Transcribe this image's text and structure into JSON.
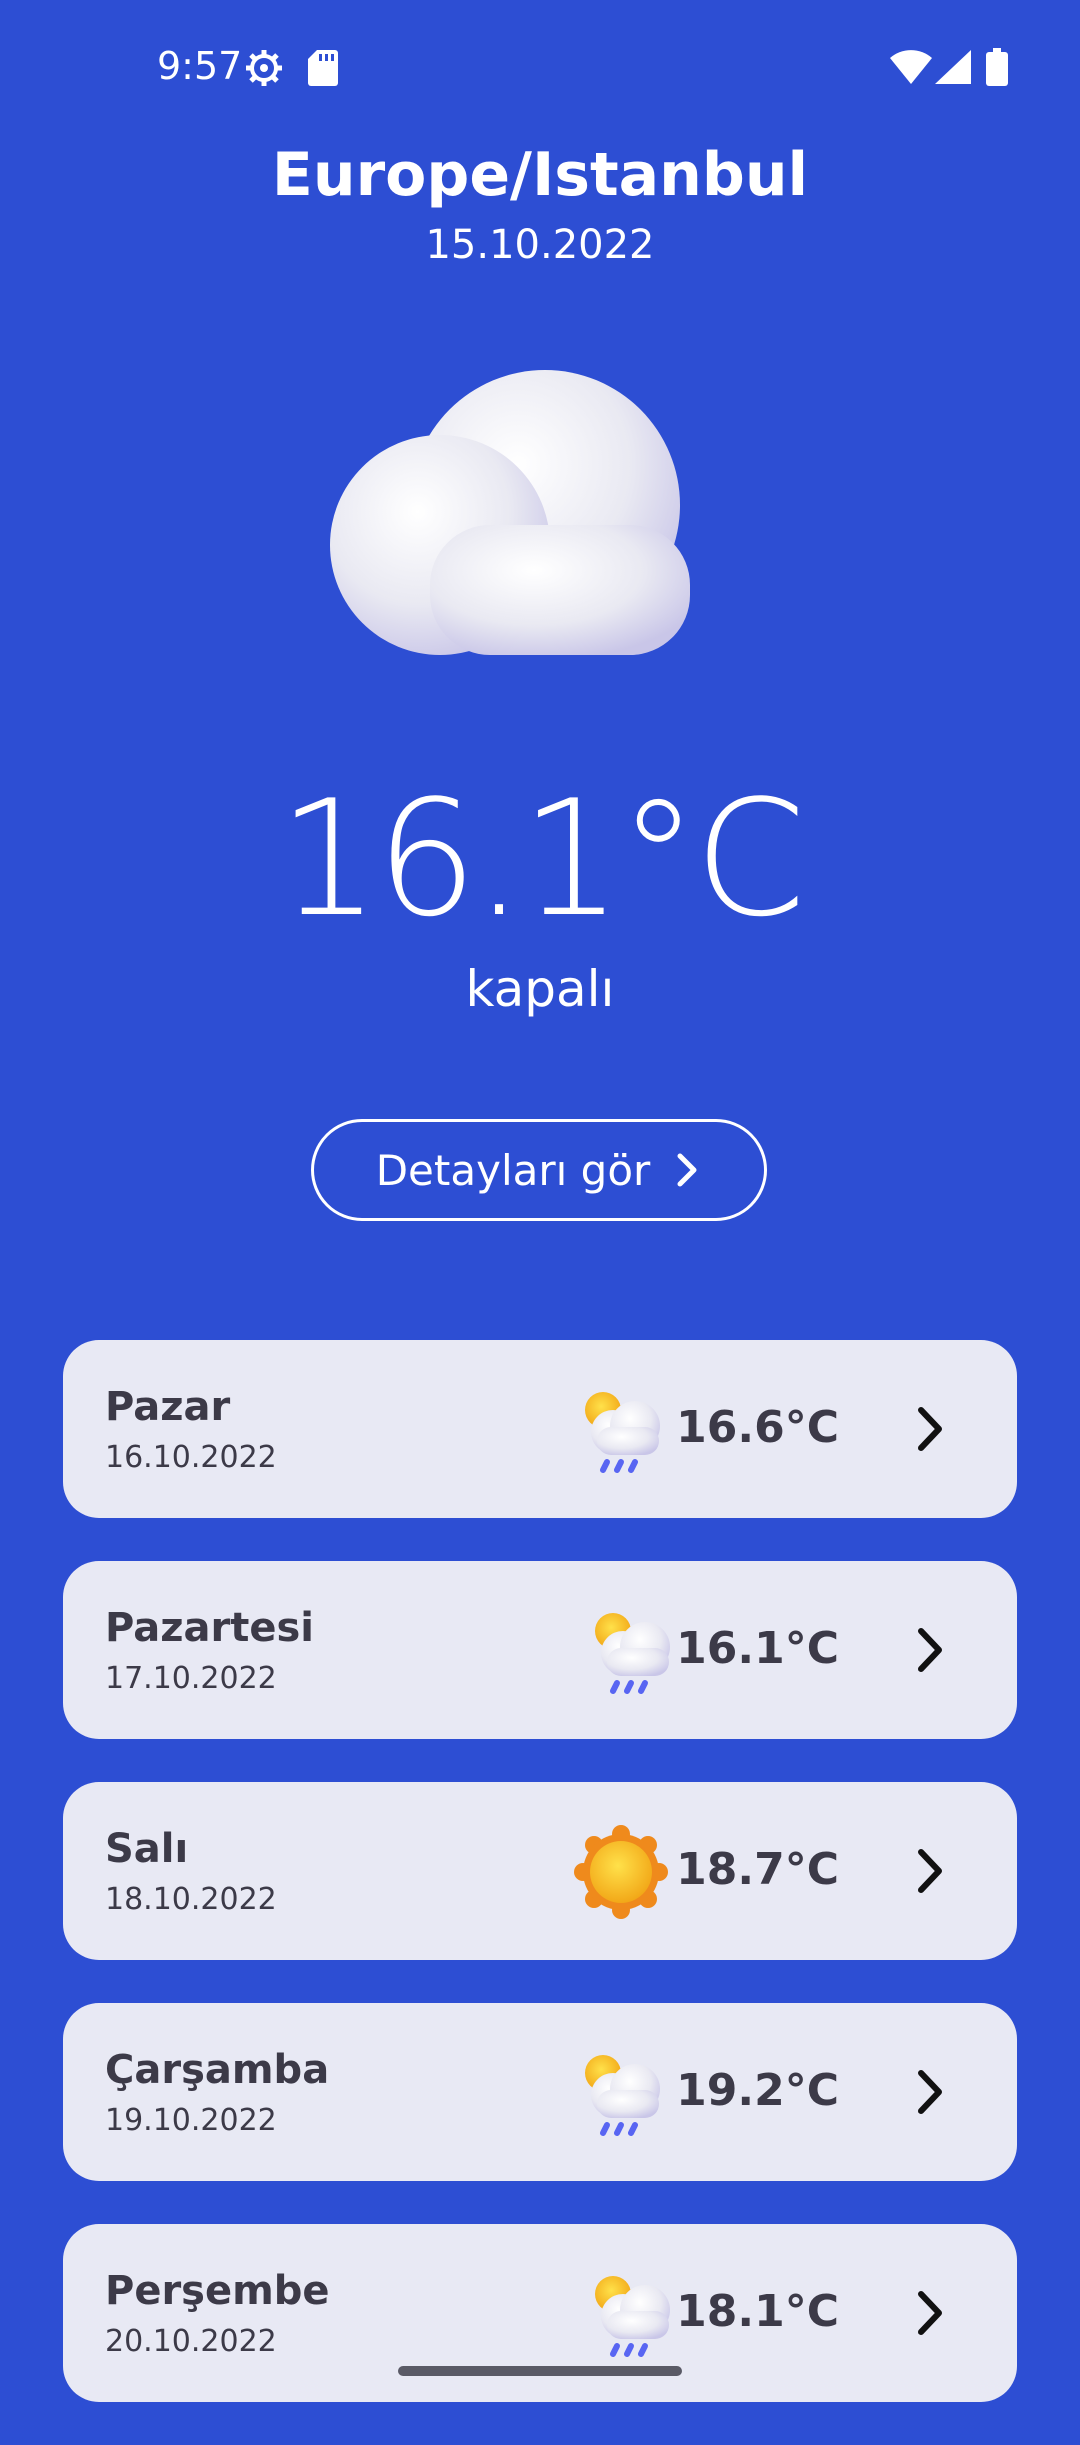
{
  "status_bar": {
    "time": "9:57",
    "icons": [
      "settings-gear-icon",
      "sd-card-icon",
      "wifi-icon",
      "signal-icon",
      "battery-icon"
    ]
  },
  "header": {
    "city": "Europe/Istanbul",
    "date": "15.10.2022"
  },
  "current": {
    "icon": "cloud-icon",
    "temperature": "16.1°C",
    "condition": "kapalı"
  },
  "details_button": {
    "label": "Detayları gör"
  },
  "forecast": [
    {
      "day": "Pazar",
      "date": "16.10.2022",
      "icon": "sun-cloud-rain-icon",
      "temp": "16.6°C"
    },
    {
      "day": "Pazartesi",
      "date": "17.10.2022",
      "icon": "sun-cloud-rain-icon",
      "temp": "16.1°C"
    },
    {
      "day": "Salı",
      "date": "18.10.2022",
      "icon": "sun-icon",
      "temp": "18.7°C"
    },
    {
      "day": "Çarşamba",
      "date": "19.10.2022",
      "icon": "sun-cloud-rain-icon",
      "temp": "19.2°C"
    },
    {
      "day": "Perşembe",
      "date": "20.10.2022",
      "icon": "sun-cloud-rain-icon",
      "temp": "18.1°C"
    }
  ],
  "colors": {
    "background": "#2d4ed3",
    "card": "#e8e9f4",
    "card_text": "#3c3a48",
    "rain": "#5865f2",
    "sun": "#f7b21b"
  }
}
